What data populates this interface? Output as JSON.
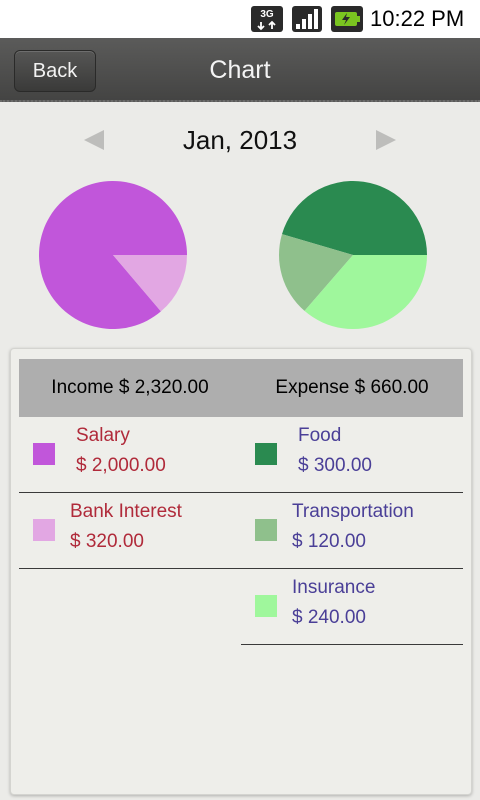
{
  "status_bar": {
    "time": "10:22 PM",
    "network_icon": "3g-data-icon",
    "signal_icon": "signal-strength-icon",
    "battery_icon": "battery-charging-icon"
  },
  "header": {
    "back_label": "Back",
    "title": "Chart"
  },
  "month_nav": {
    "label": "Jan, 2013",
    "prev_icon": "triangle-left-icon",
    "next_icon": "triangle-right-icon"
  },
  "summary": {
    "income_total": "Income $ 2,320.00",
    "expense_total": "Expense $ 660.00"
  },
  "income_items": [
    {
      "name": "Salary",
      "amount": "$ 2,000.00",
      "value": 2000,
      "color": "#c156da"
    },
    {
      "name": "Bank Interest",
      "amount": "$ 320.00",
      "value": 320,
      "color": "#e2a7e3"
    }
  ],
  "expense_items": [
    {
      "name": "Food",
      "amount": "$ 300.00",
      "value": 300,
      "color": "#2a8a50"
    },
    {
      "name": "Transportation",
      "amount": "$ 120.00",
      "value": 120,
      "color": "#8fc08c"
    },
    {
      "name": "Insurance",
      "amount": "$ 240.00",
      "value": 240,
      "color": "#9ff79c"
    }
  ],
  "colors": {
    "income_text": "#b02a3a",
    "expense_text": "#4a3f97",
    "header_bg": "#4f4f4e",
    "totals_bg": "#aeaeae"
  }
}
